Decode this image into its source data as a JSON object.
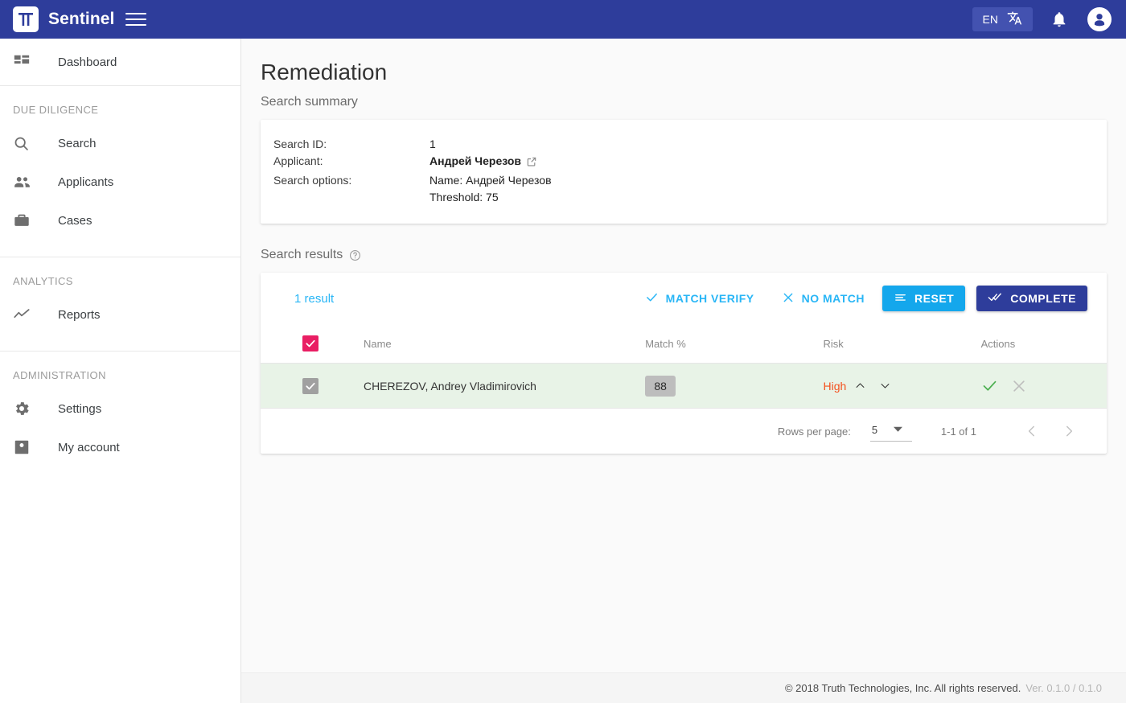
{
  "app": {
    "title": "Sentinel",
    "logo_icon": "tt-monogram-logo",
    "menu_icon": "hamburger-menu-icon",
    "language": "EN",
    "language_icon": "translate-icon",
    "notifications_icon": "bell-icon",
    "account_icon": "account-circle-icon",
    "colors": {
      "appbar": "#2e3d9b",
      "accent_blue": "#29b6f6",
      "reset_blue": "#14a7ec",
      "complete_navy": "#2e3d9b",
      "checkbox_pink": "#e91e63",
      "risk_high": "#f4511e",
      "row_selected": "#e8f3e7"
    }
  },
  "sidebar": {
    "dashboard": {
      "label": "Dashboard",
      "icon": "dashboard-icon"
    },
    "sections": [
      {
        "title": "DUE DILIGENCE",
        "items": [
          {
            "label": "Search",
            "icon": "search-icon"
          },
          {
            "label": "Applicants",
            "icon": "people-icon"
          },
          {
            "label": "Cases",
            "icon": "briefcase-icon"
          }
        ]
      },
      {
        "title": "ANALYTICS",
        "items": [
          {
            "label": "Reports",
            "icon": "trending-line-icon"
          }
        ]
      },
      {
        "title": "ADMINISTRATION",
        "items": [
          {
            "label": "Settings",
            "icon": "gear-icon"
          },
          {
            "label": "My account",
            "icon": "account-box-icon"
          }
        ]
      }
    ]
  },
  "main": {
    "page_title": "Remediation",
    "summary_heading": "Search summary",
    "summary": {
      "rows": [
        {
          "label": "Search ID:",
          "value": "1",
          "bold": false,
          "link": false
        },
        {
          "label": "Applicant:",
          "value": "Андрей Черезов",
          "bold": true,
          "link": true
        },
        {
          "label": "Search options:",
          "value": "Name: Андрей Черезов",
          "bold": false,
          "link": false
        },
        {
          "label": "",
          "value": "Threshold: 75",
          "bold": false,
          "link": false
        }
      ],
      "external_link_icon": "open-in-new-icon"
    },
    "results_heading": "Search results",
    "results_help_icon": "help-circle-icon",
    "toolbar": {
      "result_count": "1 result",
      "match_verify_label": "MATCH VERIFY",
      "match_verify_icon": "check-icon",
      "no_match_label": "NO MATCH",
      "no_match_icon": "close-icon",
      "reset_label": "RESET",
      "reset_icon": "list-lines-icon",
      "complete_label": "COMPLETE",
      "complete_icon": "double-check-icon"
    },
    "table": {
      "columns": [
        "",
        "Name",
        "Match %",
        "Risk",
        "Actions"
      ],
      "header_checkbox_checked": true,
      "rows": [
        {
          "checkbox_checked": true,
          "checkbox_disabled": true,
          "name": "CHEREZOV, Andrey Vladimirovich",
          "match": "88",
          "risk": "High",
          "risk_up_icon": "chevron-up-icon",
          "risk_down_icon": "chevron-down-icon",
          "accept_icon": "check-icon",
          "reject_icon": "close-icon",
          "selected": true
        }
      ]
    },
    "pagination": {
      "rows_per_page_label": "Rows per page:",
      "rows_per_page_value": "5",
      "dropdown_icon": "triangle-down-icon",
      "range": "1-1 of 1",
      "prev_icon": "chevron-left-icon",
      "next_icon": "chevron-right-icon"
    }
  },
  "footer": {
    "copyright": "© 2018 Truth Technologies, Inc. All rights reserved.",
    "version": "Ver. 0.1.0 / 0.1.0"
  }
}
